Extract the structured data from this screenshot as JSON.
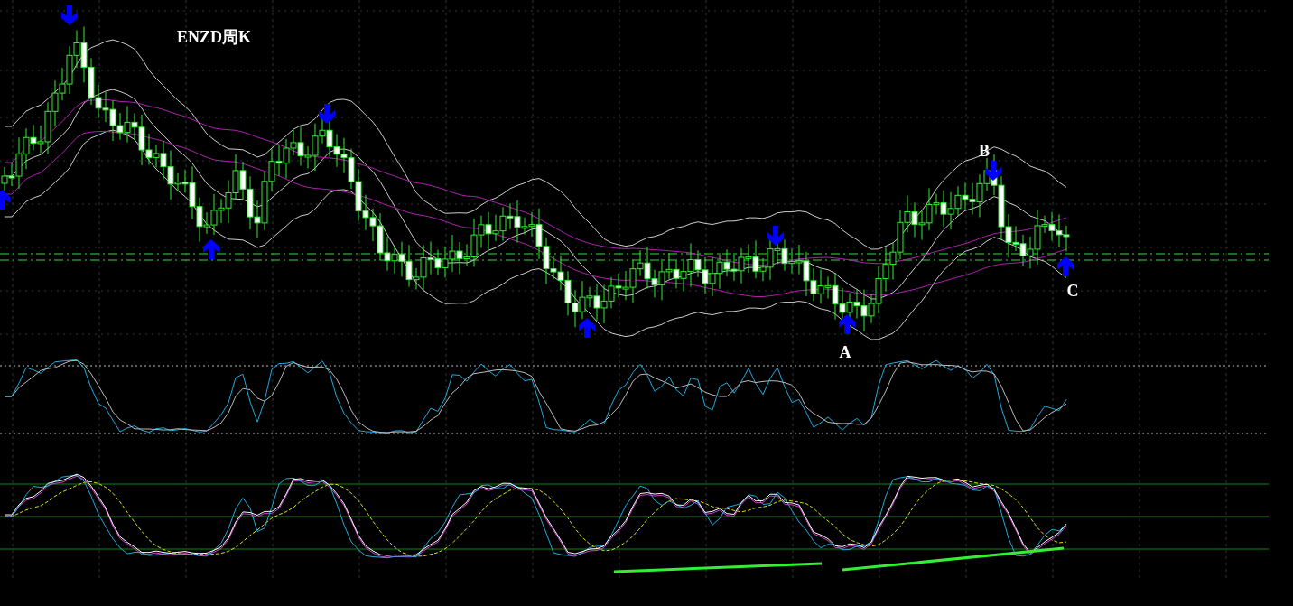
{
  "chart": {
    "title": "ENZD周K",
    "point_labels": [
      {
        "text": "A"
      },
      {
        "text": "B"
      },
      {
        "text": "C"
      }
    ]
  }
}
